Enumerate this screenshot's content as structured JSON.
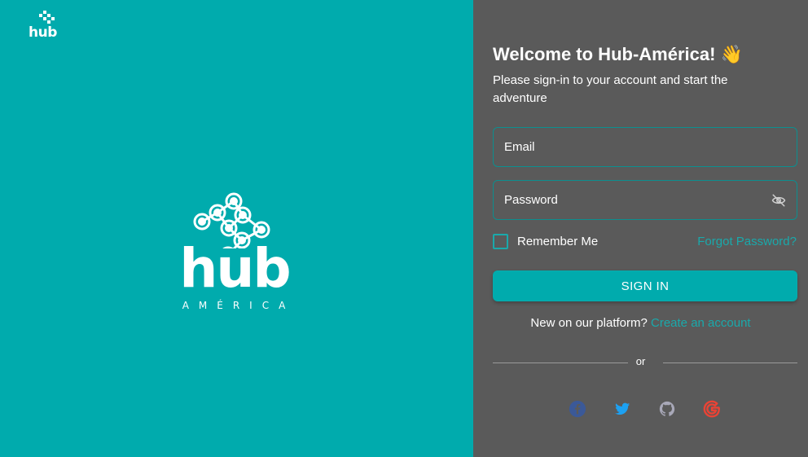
{
  "brand": {
    "corner_word": "hub",
    "hero_word": "hub",
    "hero_subtitle": "AMÉRICA",
    "accent_color": "#00abad",
    "panel_color": "#5a5a5a"
  },
  "login": {
    "title": "Welcome to Hub-América! 👋",
    "subtitle": "Please sign-in to your account and start the adventure",
    "email_placeholder": "Email",
    "password_placeholder": "Password",
    "remember_label": "Remember Me",
    "forgot_label": "Forgot Password?",
    "signin_label": "SIGN IN",
    "new_platform_text": "New on our platform?",
    "create_account_label": "Create an account",
    "divider_text": "or"
  },
  "social_icons": [
    "facebook-icon",
    "twitter-icon",
    "github-icon",
    "google-icon"
  ]
}
